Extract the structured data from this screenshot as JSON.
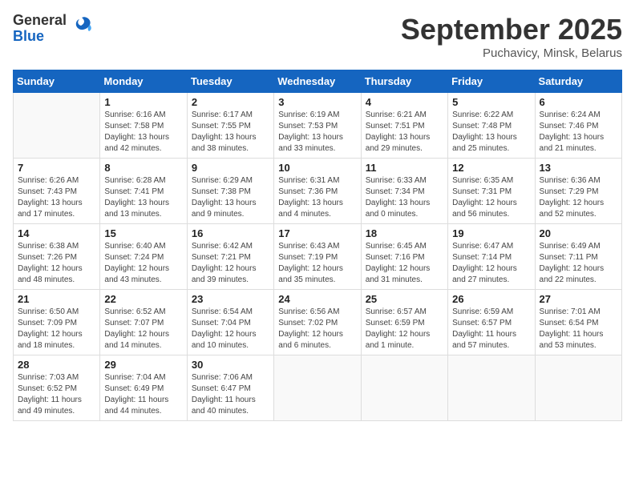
{
  "logo": {
    "general": "General",
    "blue": "Blue"
  },
  "title": "September 2025",
  "subtitle": "Puchavicy, Minsk, Belarus",
  "days_of_week": [
    "Sunday",
    "Monday",
    "Tuesday",
    "Wednesday",
    "Thursday",
    "Friday",
    "Saturday"
  ],
  "weeks": [
    [
      null,
      {
        "day": 1,
        "sunrise": "6:16 AM",
        "sunset": "7:58 PM",
        "daylight": "13 hours and 42 minutes."
      },
      {
        "day": 2,
        "sunrise": "6:17 AM",
        "sunset": "7:55 PM",
        "daylight": "13 hours and 38 minutes."
      },
      {
        "day": 3,
        "sunrise": "6:19 AM",
        "sunset": "7:53 PM",
        "daylight": "13 hours and 33 minutes."
      },
      {
        "day": 4,
        "sunrise": "6:21 AM",
        "sunset": "7:51 PM",
        "daylight": "13 hours and 29 minutes."
      },
      {
        "day": 5,
        "sunrise": "6:22 AM",
        "sunset": "7:48 PM",
        "daylight": "13 hours and 25 minutes."
      },
      {
        "day": 6,
        "sunrise": "6:24 AM",
        "sunset": "7:46 PM",
        "daylight": "13 hours and 21 minutes."
      }
    ],
    [
      {
        "day": 7,
        "sunrise": "6:26 AM",
        "sunset": "7:43 PM",
        "daylight": "13 hours and 17 minutes."
      },
      {
        "day": 8,
        "sunrise": "6:28 AM",
        "sunset": "7:41 PM",
        "daylight": "13 hours and 13 minutes."
      },
      {
        "day": 9,
        "sunrise": "6:29 AM",
        "sunset": "7:38 PM",
        "daylight": "13 hours and 9 minutes."
      },
      {
        "day": 10,
        "sunrise": "6:31 AM",
        "sunset": "7:36 PM",
        "daylight": "13 hours and 4 minutes."
      },
      {
        "day": 11,
        "sunrise": "6:33 AM",
        "sunset": "7:34 PM",
        "daylight": "13 hours and 0 minutes."
      },
      {
        "day": 12,
        "sunrise": "6:35 AM",
        "sunset": "7:31 PM",
        "daylight": "12 hours and 56 minutes."
      },
      {
        "day": 13,
        "sunrise": "6:36 AM",
        "sunset": "7:29 PM",
        "daylight": "12 hours and 52 minutes."
      }
    ],
    [
      {
        "day": 14,
        "sunrise": "6:38 AM",
        "sunset": "7:26 PM",
        "daylight": "12 hours and 48 minutes."
      },
      {
        "day": 15,
        "sunrise": "6:40 AM",
        "sunset": "7:24 PM",
        "daylight": "12 hours and 43 minutes."
      },
      {
        "day": 16,
        "sunrise": "6:42 AM",
        "sunset": "7:21 PM",
        "daylight": "12 hours and 39 minutes."
      },
      {
        "day": 17,
        "sunrise": "6:43 AM",
        "sunset": "7:19 PM",
        "daylight": "12 hours and 35 minutes."
      },
      {
        "day": 18,
        "sunrise": "6:45 AM",
        "sunset": "7:16 PM",
        "daylight": "12 hours and 31 minutes."
      },
      {
        "day": 19,
        "sunrise": "6:47 AM",
        "sunset": "7:14 PM",
        "daylight": "12 hours and 27 minutes."
      },
      {
        "day": 20,
        "sunrise": "6:49 AM",
        "sunset": "7:11 PM",
        "daylight": "12 hours and 22 minutes."
      }
    ],
    [
      {
        "day": 21,
        "sunrise": "6:50 AM",
        "sunset": "7:09 PM",
        "daylight": "12 hours and 18 minutes."
      },
      {
        "day": 22,
        "sunrise": "6:52 AM",
        "sunset": "7:07 PM",
        "daylight": "12 hours and 14 minutes."
      },
      {
        "day": 23,
        "sunrise": "6:54 AM",
        "sunset": "7:04 PM",
        "daylight": "12 hours and 10 minutes."
      },
      {
        "day": 24,
        "sunrise": "6:56 AM",
        "sunset": "7:02 PM",
        "daylight": "12 hours and 6 minutes."
      },
      {
        "day": 25,
        "sunrise": "6:57 AM",
        "sunset": "6:59 PM",
        "daylight": "12 hours and 1 minute."
      },
      {
        "day": 26,
        "sunrise": "6:59 AM",
        "sunset": "6:57 PM",
        "daylight": "11 hours and 57 minutes."
      },
      {
        "day": 27,
        "sunrise": "7:01 AM",
        "sunset": "6:54 PM",
        "daylight": "11 hours and 53 minutes."
      }
    ],
    [
      {
        "day": 28,
        "sunrise": "7:03 AM",
        "sunset": "6:52 PM",
        "daylight": "11 hours and 49 minutes."
      },
      {
        "day": 29,
        "sunrise": "7:04 AM",
        "sunset": "6:49 PM",
        "daylight": "11 hours and 44 minutes."
      },
      {
        "day": 30,
        "sunrise": "7:06 AM",
        "sunset": "6:47 PM",
        "daylight": "11 hours and 40 minutes."
      },
      null,
      null,
      null,
      null
    ]
  ]
}
